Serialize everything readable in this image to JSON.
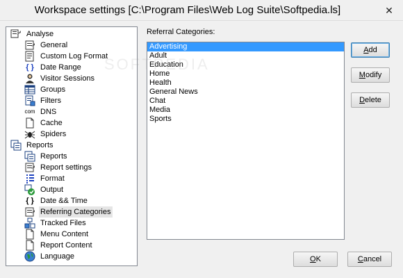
{
  "window": {
    "title": "Workspace settings [C:\\Program Files\\Web Log Suite\\Softpedia.ls]",
    "close_glyph": "✕"
  },
  "tree": {
    "items": [
      {
        "label": "Analyse",
        "icon": "analyse-icon",
        "level": 0
      },
      {
        "label": "General",
        "icon": "general-icon",
        "level": 1
      },
      {
        "label": "Custom Log Format",
        "icon": "custom-log-format-icon",
        "level": 1
      },
      {
        "label": "Date Range",
        "icon": "date-range-icon",
        "level": 1
      },
      {
        "label": "Visitor Sessions",
        "icon": "visitor-sessions-icon",
        "level": 1
      },
      {
        "label": "Groups",
        "icon": "groups-icon",
        "level": 1
      },
      {
        "label": "Filters",
        "icon": "filters-icon",
        "level": 1
      },
      {
        "label": "DNS",
        "icon": "dns-icon",
        "level": 1
      },
      {
        "label": "Cache",
        "icon": "cache-icon",
        "level": 1
      },
      {
        "label": "Spiders",
        "icon": "spiders-icon",
        "level": 1
      },
      {
        "label": "Reports",
        "icon": "reports-root-icon",
        "level": 0
      },
      {
        "label": "Reports",
        "icon": "reports-icon",
        "level": 1
      },
      {
        "label": "Report settings",
        "icon": "report-settings-icon",
        "level": 1
      },
      {
        "label": "Format",
        "icon": "format-icon",
        "level": 1
      },
      {
        "label": "Output",
        "icon": "output-icon",
        "level": 1
      },
      {
        "label": "Date && Time",
        "icon": "date-time-icon",
        "level": 1
      },
      {
        "label": "Referring Categories",
        "icon": "referring-categories-icon",
        "level": 1,
        "selected": true
      },
      {
        "label": "Tracked Files",
        "icon": "tracked-files-icon",
        "level": 1
      },
      {
        "label": "Menu Content",
        "icon": "menu-content-icon",
        "level": 1
      },
      {
        "label": "Report Content",
        "icon": "report-content-icon",
        "level": 1
      },
      {
        "label": "Language",
        "icon": "language-icon",
        "level": 1
      }
    ],
    "glyphs": {
      "date_range": "{ }",
      "date_time": "{ }",
      "dns": "com"
    }
  },
  "main": {
    "list_label": "Referral Categories:",
    "categories": [
      "Advertising",
      "Adult",
      "Education",
      "Home",
      "Health",
      "General News",
      "Chat",
      "Media",
      "Sports"
    ],
    "selected_index": 0
  },
  "buttons": {
    "add_prefix": "",
    "add_u": "A",
    "add_suffix": "dd",
    "modify_prefix": "",
    "modify_u": "M",
    "modify_suffix": "odify",
    "delete_prefix": "",
    "delete_u": "D",
    "delete_suffix": "elete",
    "ok_prefix": "",
    "ok_u": "O",
    "ok_suffix": "K",
    "cancel_prefix": "",
    "cancel_u": "C",
    "cancel_suffix": "ancel"
  },
  "watermark": "SOFTPEDIA",
  "colors": {
    "selection_blue": "#3399ff",
    "tree_highlight": "#e5e5e5",
    "border": "#828790"
  }
}
